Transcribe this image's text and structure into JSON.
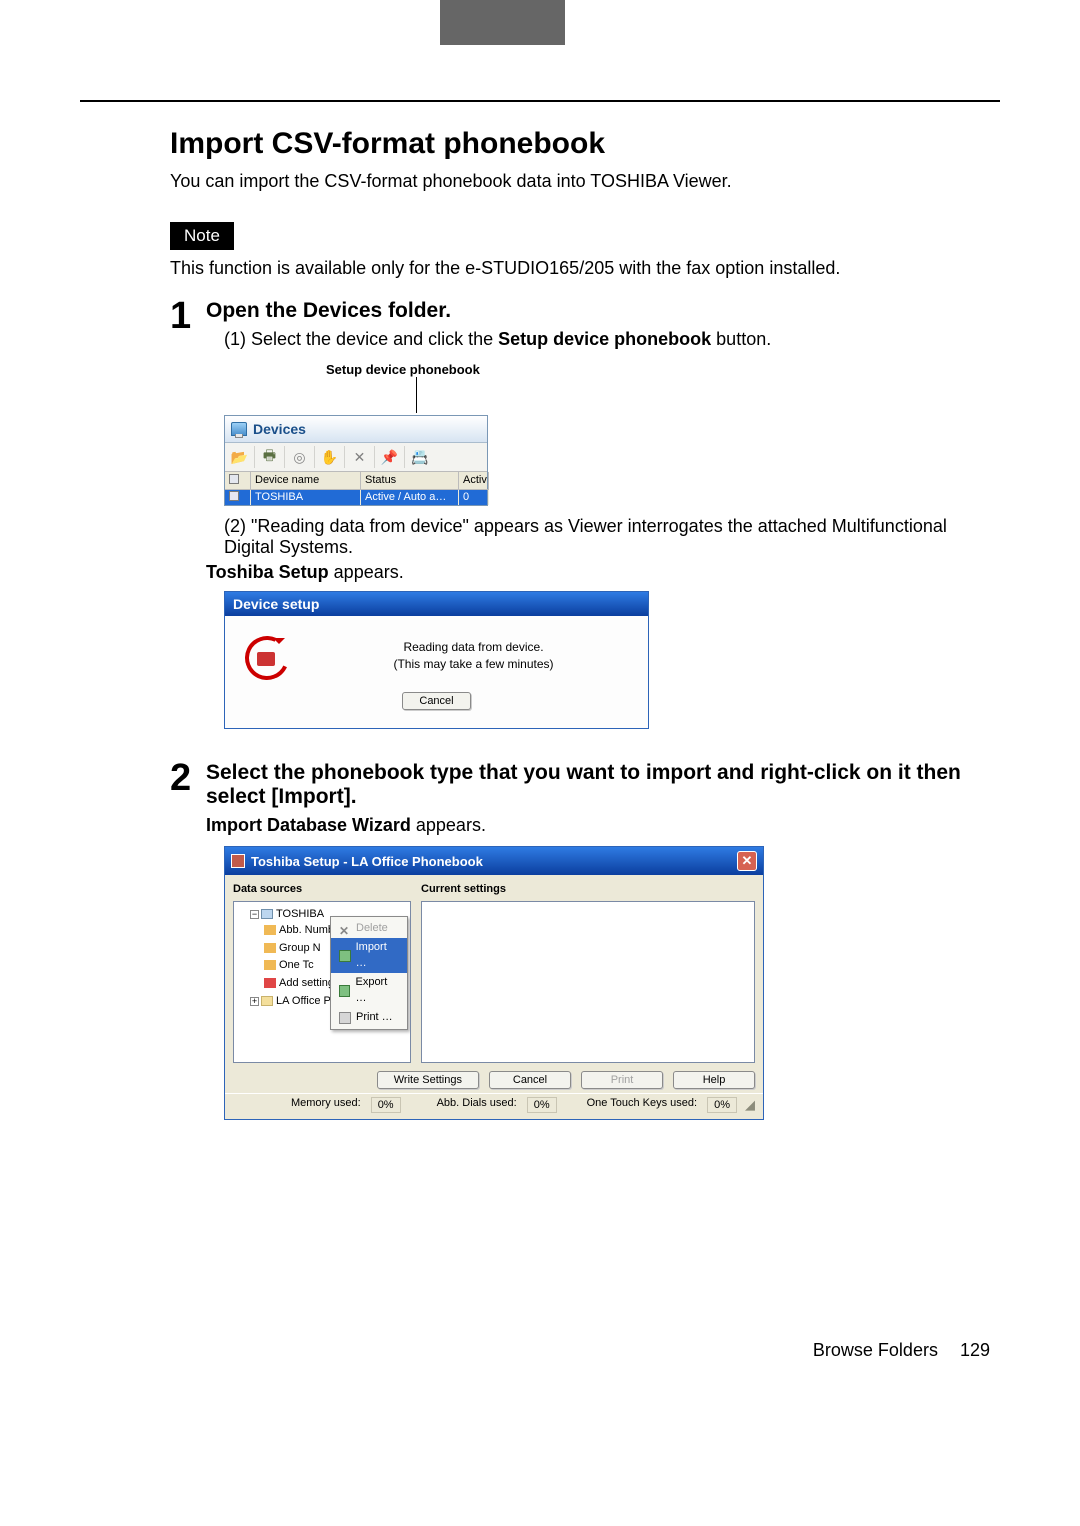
{
  "page": {
    "title": "Import CSV-format phonebook",
    "intro": "You can import the CSV-format phonebook data into TOSHIBA Viewer.",
    "note_label": "Note",
    "note_text": "This function is available only for the e-STUDIO165/205 with the fax option installed.",
    "footer_section": "Browse Folders",
    "footer_page": "129"
  },
  "step1": {
    "num": "1",
    "title": "Open the Devices folder.",
    "sub1_prefix": "(1) Select the device and click the ",
    "sub1_bold": "Setup device phonebook",
    "sub1_suffix": " button.",
    "callout_label": "Setup device phonebook",
    "sub2_prefix": "(2) \"Reading data from device\" appears as Viewer interrogates the attached Multifunctional Digital Systems.",
    "sub2_line2_bold": "Toshiba Setup",
    "sub2_line2_suffix": " appears."
  },
  "devices_window": {
    "header": "Devices",
    "col_lock": "",
    "col_name": "Device name",
    "col_status": "Status",
    "col_activ": "Activ",
    "row1_name": "TOSHIBA",
    "row1_status": "Active / Auto a…",
    "row1_activ": "0"
  },
  "device_setup_dialog": {
    "title": "Device setup",
    "msg1": "Reading data from device.",
    "msg2": "(This may take a few minutes)",
    "cancel": "Cancel"
  },
  "step2": {
    "num": "2",
    "title": "Select the phonebook type that you want to import and right-click on it then select [Import].",
    "line2_bold": "Import Database Wizard",
    "line2_suffix": " appears."
  },
  "la_window": {
    "title": "Toshiba Setup - LA Office Phonebook",
    "left_header": "Data sources",
    "right_header": "Current settings",
    "tree_root": "TOSHIBA",
    "tree_abb": "Abb. Numbers",
    "tree_group": "Group N",
    "tree_one": "One Tc",
    "tree_add": "Add settings",
    "tree_la": "LA Office P",
    "ctx_delete": "Delete",
    "ctx_import": "Import …",
    "ctx_export": "Export …",
    "ctx_print": "Print …",
    "btn_write": "Write Settings",
    "btn_cancel": "Cancel",
    "btn_print": "Print",
    "btn_help": "Help",
    "status_mem_label": "Memory used:",
    "status_mem_val": "0%",
    "status_abb_label": "Abb. Dials used:",
    "status_abb_val": "0%",
    "status_one_label": "One Touch Keys used:",
    "status_one_val": "0%"
  }
}
